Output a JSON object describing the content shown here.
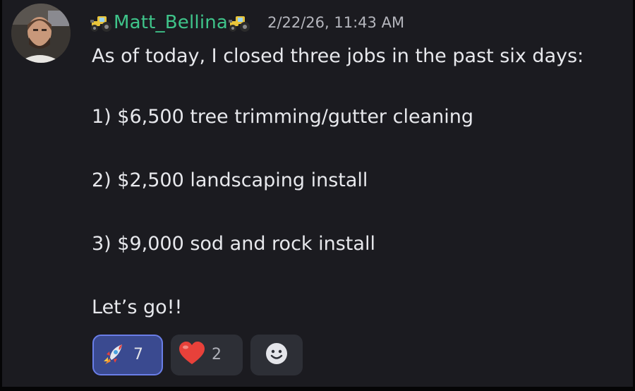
{
  "message": {
    "author": "Matt_Bellina",
    "author_badge_icon": "tractor-icon",
    "timestamp": "2/22/26, 11:43 AM",
    "lines": [
      "As of today, I closed three jobs in the past six days:",
      "1) $6,500 tree trimming/gutter cleaning",
      "2) $2,500 landscaping install",
      "3) $9,000 sod and rock install",
      "Let’s go!!"
    ]
  },
  "reactions": [
    {
      "emoji": "rocket-icon",
      "count": "7",
      "active": true
    },
    {
      "emoji": "heart-icon",
      "count": "2",
      "active": false
    }
  ],
  "add_reaction_icon": "smiley-icon",
  "colors": {
    "background": "#1b1b20",
    "username": "#3fc48a",
    "text": "#e7e8ec",
    "timestamp": "#b5b6bd",
    "reaction_bg": "#2d2f36",
    "reaction_active_bg": "#3a4a90",
    "reaction_active_border": "#6a7ee8"
  }
}
